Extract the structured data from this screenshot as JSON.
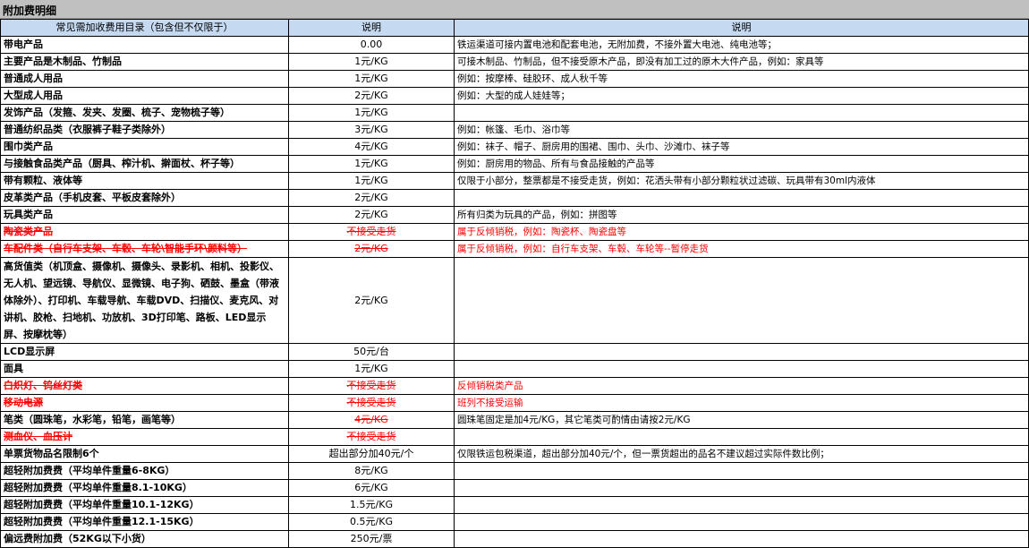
{
  "sheet_title": "附加费明细",
  "headers": [
    "常见需加收费用目录（包含但不仅限于）",
    "说明",
    "说明"
  ],
  "rows": [
    {
      "c1": "带电产品",
      "c2": "0.00",
      "c3": "铁运渠道可接内置电池和配套电池，无附加费，不接外置大电池、纯电池等；",
      "strike": false,
      "h": 19
    },
    {
      "c1": "主要产品是木制品、竹制品",
      "c2": "1元/KG",
      "c3": "可接木制品、竹制品，但不接受原木产品，即没有加工过的原木大件产品，例如：家具等",
      "strike": false,
      "h": 19
    },
    {
      "c1": "普通成人用品",
      "c2": "1元/KG",
      "c3": "例如：按摩棒、硅胶环、成人秋千等",
      "strike": false,
      "h": 19
    },
    {
      "c1": "大型成人用品",
      "c2": "2元/KG",
      "c3": "例如：大型的成人娃娃等；",
      "strike": false,
      "h": 19
    },
    {
      "c1": "发饰产品（发箍、发夹、发圈、梳子、宠物梳子等）",
      "c2": "1元/KG",
      "c3": "",
      "strike": false,
      "h": 19
    },
    {
      "c1": "普通纺织品类（衣服裤子鞋子类除外）",
      "c2": "3元/KG",
      "c3": "例如：帐篷、毛巾、浴巾等",
      "strike": false,
      "h": 19
    },
    {
      "c1": "围巾类产品",
      "c2": "4元/KG",
      "c3": "例如：袜子、帽子、厨房用的围裙、围巾、头巾、沙滩巾、袜子等",
      "strike": false,
      "h": 19
    },
    {
      "c1": "与接触食品类产品（厨具、榨汁机、擀面杖、杯子等）",
      "c2": "1元/KG",
      "c3": "例如：厨房用的物品、所有与食品接触的产品等",
      "strike": false,
      "h": 19
    },
    {
      "c1": "带有颗粒、液体等",
      "c2": "1元/KG",
      "c3": "仅限于小部分，整票都是不接受走货，例如：花洒头带有小部分颗粒状过滤碳、玩具带有30ml内液体",
      "strike": false,
      "h": 19
    },
    {
      "c1": "皮革类产品（手机皮套、平板皮套除外）",
      "c2": "2元/KG",
      "c3": "",
      "strike": false,
      "h": 19
    },
    {
      "c1": "玩具类产品",
      "c2": "2元/KG",
      "c3": "所有归类为玩具的产品，例如：拼图等",
      "strike": false,
      "h": 19
    },
    {
      "c1": "陶瓷类产品",
      "c2": "不接受走货",
      "c3": "属于反倾销税，例如：陶瓷杯、陶瓷盘等",
      "strike": true,
      "h": 19
    },
    {
      "c1": "车配件类（自行车支架、车毂、车轮\\智能手环\\颜料等）",
      "c2": "2元/KG",
      "c3": "属于反倾销税，例如：自行车支架、车毂、车轮等--暂停走货",
      "strike": true,
      "h": 19
    },
    {
      "c1": "高货值类（机顶盒、摄像机、摄像头、录影机、相机、投影仪、无人机、望远镜、导航仪、显微镜、电子狗、硒鼓、墨盒（带液体除外）、打印机、车载导航、车载DVD、扫描仪、麦克风、对讲机、胶枪、扫地机、功放机、3D打印笔、路板、LED显示屏、按摩枕等）",
      "c2": "2元/KG",
      "c3": "",
      "strike": false,
      "h": 96,
      "wrap": true
    },
    {
      "c1": "LCD显示屏",
      "c2": "50元/台",
      "c3": "",
      "strike": false,
      "h": 19
    },
    {
      "c1": "面具",
      "c2": "1元/KG",
      "c3": "",
      "strike": false,
      "h": 19
    },
    {
      "c1": "白炽灯、钨丝灯类",
      "c2": "不接受走货",
      "c3": "反倾销税类产品",
      "strike": true,
      "h": 19
    },
    {
      "c1": "移动电源",
      "c2": "不接受走货",
      "c3": "班列不接受运输",
      "strike": true,
      "h": 19
    },
    {
      "c1": "笔类（圆珠笔，水彩笔，铅笔，画笔等）",
      "c2": "4元/KG",
      "c3": "圆珠笔固定是加4元/KG，其它笔类可酌情由请按2元/KG",
      "strike": false,
      "strike_c2": true,
      "h": 19
    },
    {
      "c1": "测血仪、血压计",
      "c2": "不接受走货",
      "c3": "",
      "strike": true,
      "h": 19
    },
    {
      "c1": "单票货物品名限制6个",
      "c2": "超出部分加40元/个",
      "c3": "仅限铁运包税渠道，超出部分加40元/个，但一票货超出的品名不建议超过实际件数比例；",
      "strike": false,
      "h": 19
    },
    {
      "c1": "超轻附加费费（平均单件重量6-8KG）",
      "c2": "8元/KG",
      "c3": "",
      "strike": false,
      "h": 19
    },
    {
      "c1": "超轻附加费费（平均单件重量8.1-10KG）",
      "c2": "6元/KG",
      "c3": "",
      "strike": false,
      "h": 19
    },
    {
      "c1": "超轻附加费费（平均单件重量10.1-12KG）",
      "c2": "1.5元/KG",
      "c3": "",
      "strike": false,
      "h": 19
    },
    {
      "c1": "超轻附加费费（平均单件重量12.1-15KG）",
      "c2": "0.5元/KG",
      "c3": "",
      "strike": false,
      "h": 19
    },
    {
      "c1": "偏远费附加费（52KG以下小货）",
      "c2": "250元/票",
      "c3": "",
      "strike": false,
      "h": 19
    }
  ]
}
